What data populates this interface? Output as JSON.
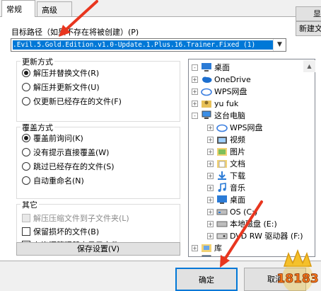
{
  "tabs": [
    {
      "label": "常规",
      "active": true
    },
    {
      "label": "高级",
      "active": false
    }
  ],
  "target_path": {
    "label": "目标路径（如果不存在将被创建）(P)",
    "value": ".Evil.5.Gold.Edition.v1.0-Update.1.Plus.16.Trainer.Fixed (1)"
  },
  "side_buttons": {
    "show": "显",
    "new_folder": "新建文"
  },
  "update_mode": {
    "title": "更新方式",
    "options": [
      {
        "label": "解压并替换文件(R)",
        "selected": true
      },
      {
        "label": "解压并更新文件(U)",
        "selected": false
      },
      {
        "label": "仅更新已经存在的文件(F)",
        "selected": false
      }
    ]
  },
  "overwrite_mode": {
    "title": "覆盖方式",
    "options": [
      {
        "label": "覆盖前询问(K)",
        "selected": true
      },
      {
        "label": "没有提示直接覆盖(W)",
        "selected": false
      },
      {
        "label": "跳过已经存在的文件(S)",
        "selected": false
      },
      {
        "label": "自动重命名(N)",
        "selected": false
      }
    ]
  },
  "misc": {
    "title": "其它",
    "options": [
      {
        "label": "解压压缩文件到子文件夹(L)",
        "checked": false,
        "disabled": true
      },
      {
        "label": "保留损坏的文件(B)",
        "checked": false,
        "disabled": false
      },
      {
        "label": "在资源管理器中显示文件(X)",
        "checked": false,
        "disabled": false
      }
    ]
  },
  "save_settings_label": "保存设置(V)",
  "tree": [
    {
      "label": "桌面",
      "icon": "desktop-icon",
      "expander": "-",
      "level": 0
    },
    {
      "label": "OneDrive",
      "icon": "onedrive-cloud-icon",
      "expander": "+",
      "level": 1
    },
    {
      "label": "WPS网盘",
      "icon": "wps-cloud-icon",
      "expander": "+",
      "level": 1
    },
    {
      "label": "yu fuk",
      "icon": "user-icon",
      "expander": "+",
      "level": 1
    },
    {
      "label": "这台电脑",
      "icon": "computer-icon",
      "expander": "-",
      "level": 1
    },
    {
      "label": "WPS网盘",
      "icon": "wps-cloud-icon",
      "expander": "+",
      "level": 2
    },
    {
      "label": "视频",
      "icon": "video-folder-icon",
      "expander": "+",
      "level": 2
    },
    {
      "label": "图片",
      "icon": "pictures-folder-icon",
      "expander": "+",
      "level": 2
    },
    {
      "label": "文档",
      "icon": "documents-folder-icon",
      "expander": "+",
      "level": 2
    },
    {
      "label": "下载",
      "icon": "downloads-folder-icon",
      "expander": "+",
      "level": 2
    },
    {
      "label": "音乐",
      "icon": "music-folder-icon",
      "expander": "+",
      "level": 2
    },
    {
      "label": "桌面",
      "icon": "desktop-folder-icon",
      "expander": "+",
      "level": 2
    },
    {
      "label": "OS (C:)",
      "icon": "drive-c-icon",
      "expander": "+",
      "level": 2
    },
    {
      "label": "本地磁盘 (E:)",
      "icon": "drive-e-icon",
      "expander": "+",
      "level": 2
    },
    {
      "label": "DVD RW 驱动器 (F:)",
      "icon": "dvd-drive-icon",
      "expander": "+",
      "level": 2
    },
    {
      "label": "库",
      "icon": "library-icon",
      "expander": "+",
      "level": 1
    },
    {
      "label": "网络",
      "icon": "network-icon",
      "expander": "+",
      "level": 1
    }
  ],
  "footer": {
    "ok": "确定",
    "cancel": "取消"
  },
  "watermark_text": "18183",
  "colors": {
    "selection": "#0078d7",
    "annotation_arrow": "#e8361f"
  }
}
